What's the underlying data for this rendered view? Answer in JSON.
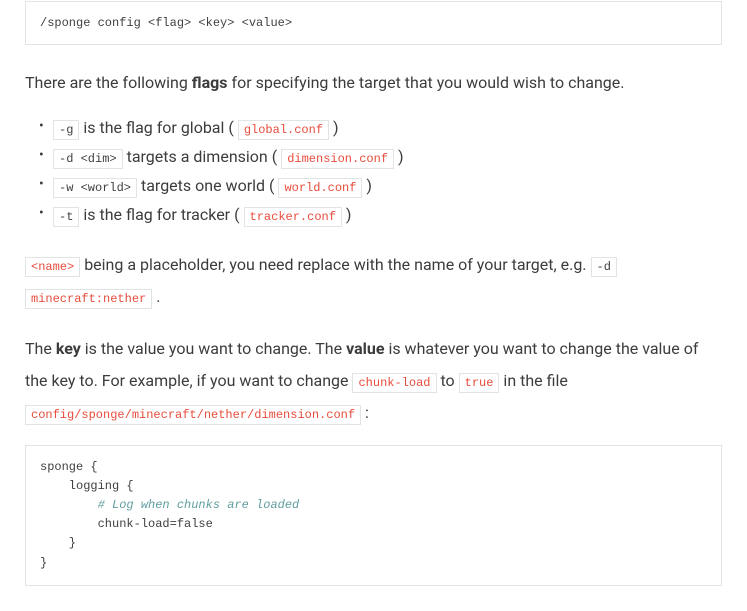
{
  "cmdTemplate": "/sponge config <flag> <key> <value>",
  "intro1": "There are the following ",
  "introBold": "flags",
  "intro2": " for specifying the target that you would wish to change.",
  "flags": [
    {
      "code": "-g",
      "t1": " is the flag for global ( ",
      "file": "global.conf",
      "t2": " )"
    },
    {
      "code": "-d <dim>",
      "t1": " targets a dimension ( ",
      "file": "dimension.conf",
      "t2": " )"
    },
    {
      "code": "-w <world>",
      "t1": " targets one world ( ",
      "file": "world.conf",
      "t2": " )"
    },
    {
      "code": "-t",
      "t1": " is the flag for tracker ( ",
      "file": "tracker.conf",
      "t2": " )"
    }
  ],
  "placeholderCode": "<name>",
  "placeholderText": " being a placeholder, you need replace with the name of your target, e.g. ",
  "placeholderExampleFlag": "-d",
  "placeholderExampleArg": "minecraft:nether",
  "placeholderEnd": " .",
  "kv1": "The ",
  "kvKey": "key",
  "kv2": " is the value you want to change. The ",
  "kvValue": "value",
  "kv3": " is whatever you want to change the value of the key to. For example, if you want to change ",
  "kvCode1": "chunk-load",
  "kv4": " to ",
  "kvCode2": "true",
  "kv5": " in the file ",
  "kvFile": "config/sponge/minecraft/nether/dimension.conf",
  "kv6": " :",
  "example": {
    "l1": "sponge {",
    "l2": "    logging {",
    "l3c": "        # Log when chunks are loaded",
    "l4": "        chunk-load=false",
    "l5": "    }",
    "l6": "}"
  }
}
